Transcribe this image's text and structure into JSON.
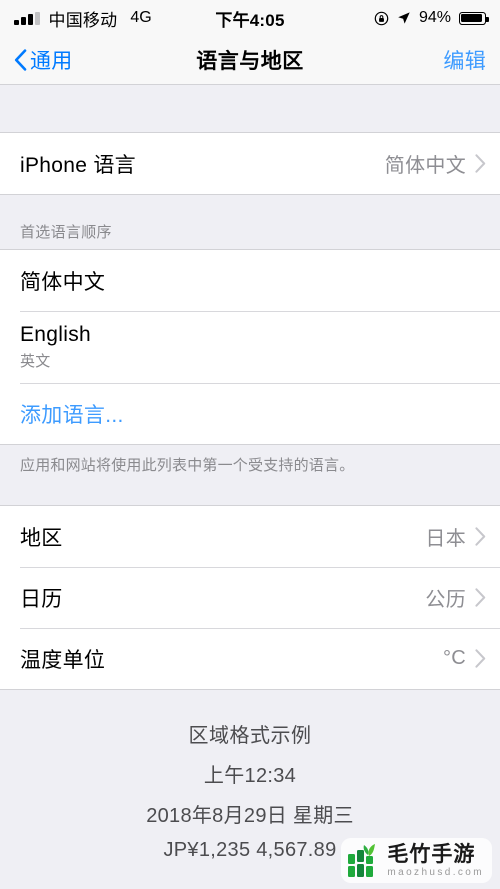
{
  "status_bar": {
    "carrier": "中国移动",
    "network": "4G",
    "time": "下午4:05",
    "battery_percent": "94%",
    "signal_bars_filled": 3,
    "signal_bars_total": 4,
    "icons": [
      "signal-bars-icon",
      "rotation-lock-icon",
      "location-arrow-icon",
      "battery-icon"
    ]
  },
  "nav": {
    "back_label": "通用",
    "title": "语言与地区",
    "edit_label": "编辑"
  },
  "iphone_language": {
    "label": "iPhone 语言",
    "value": "简体中文"
  },
  "preferred_order": {
    "header": "首选语言顺序",
    "items": [
      {
        "label": "简体中文",
        "sub": ""
      },
      {
        "label": "English",
        "sub": "英文"
      }
    ],
    "add_language_label": "添加语言...",
    "footer": "应用和网站将使用此列表中第一个受支持的语言。"
  },
  "region_group": {
    "rows": [
      {
        "label": "地区",
        "value": "日本"
      },
      {
        "label": "日历",
        "value": "公历"
      },
      {
        "label": "温度单位",
        "value": "°C"
      }
    ]
  },
  "region_example": {
    "title": "区域格式示例",
    "lines": [
      "上午12:34",
      "2018年8月29日 星期三",
      "JP¥1,235  4,567.89"
    ]
  },
  "watermark": {
    "name": "毛竹手游",
    "url": "maozhusd.com"
  },
  "colors": {
    "accent_blue": "#007aff",
    "link_blue": "#3d9bff",
    "value_gray": "#8e8e93",
    "bg_gray": "#efeff4",
    "watermark_green": "#1faa3c"
  }
}
